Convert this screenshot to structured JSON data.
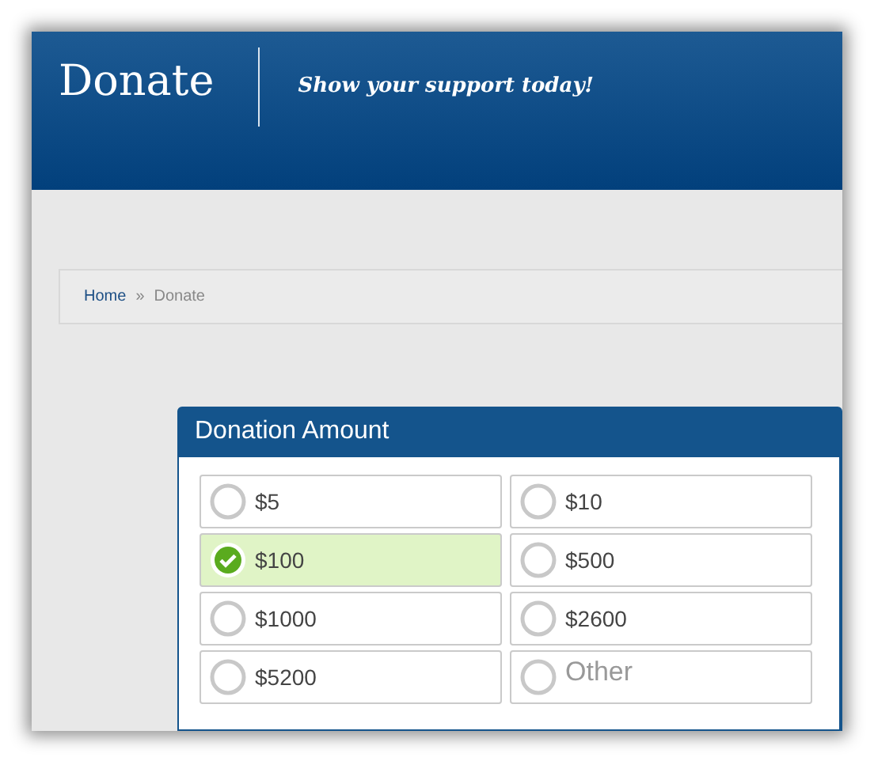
{
  "header": {
    "title": "Donate",
    "tagline": "Show your support today!"
  },
  "breadcrumb": [
    {
      "label": "Home",
      "link": true
    },
    {
      "label": "»",
      "link": false
    },
    {
      "label": "Donate",
      "link": false
    }
  ],
  "donation": {
    "title": "Donation Amount",
    "options": [
      {
        "kind": "amount",
        "label": "$5",
        "selected": false
      },
      {
        "kind": "amount",
        "label": "$10",
        "selected": false
      },
      {
        "kind": "amount",
        "label": "$100",
        "selected": true
      },
      {
        "kind": "amount",
        "label": "$500",
        "selected": false
      },
      {
        "kind": "amount",
        "label": "$1000",
        "selected": false
      },
      {
        "kind": "amount",
        "label": "$2600",
        "selected": false
      },
      {
        "kind": "amount",
        "label": "$5200",
        "selected": false
      },
      {
        "kind": "other",
        "placeholder": "Other",
        "selected": false
      }
    ]
  }
}
